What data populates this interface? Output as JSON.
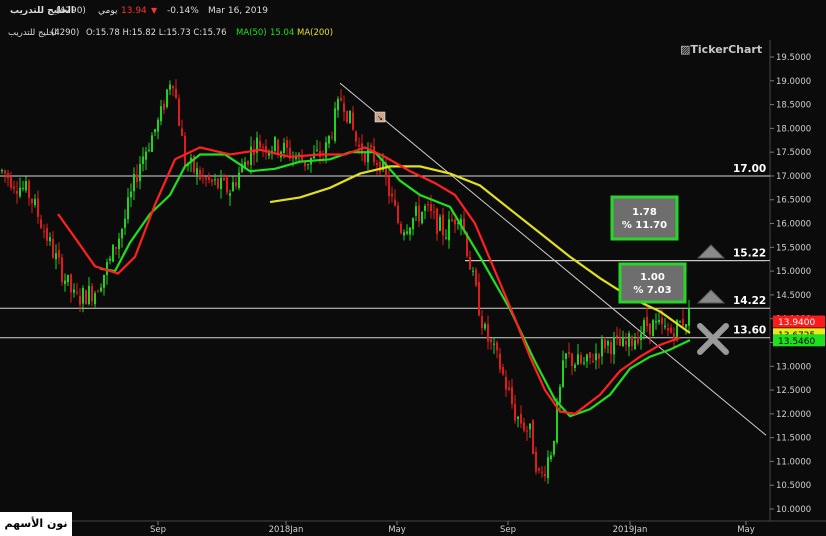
{
  "header": {
    "title": "الخليج للتدريب",
    "code": "(4290)",
    "period": "يومي",
    "price": "13.94",
    "change": "-0.14%",
    "date": "Mar 16, 2019",
    "ohlc_name": "الخليج للتدريب",
    "ohlc_code": "(4290)",
    "ohlc": "O:15.78  H:15.82  L:15.73  C:15.76",
    "ma50_label": "MA(50)",
    "ma50_value": "15.04",
    "ma200_label": "MA(200)"
  },
  "brand": "TickerChart",
  "watermark": "نون الأسهم",
  "colors": {
    "background": "#0b0b0b",
    "up": "#1fd31f",
    "down": "#e01b1b",
    "ma50": "#1fe01f",
    "ma200": "#e0e01f",
    "ma_red": "#ff2020",
    "level_line": "#d8d8d8",
    "box_border": "#2ad52a",
    "box_fill": "#6e6e6e"
  },
  "chart_data": {
    "type": "candlestick",
    "ylim": [
      9.8,
      19.8
    ],
    "y_ticks": [
      "19.5000",
      "19.0000",
      "18.5000",
      "18.0000",
      "17.5000",
      "17.0000",
      "16.5000",
      "16.0000",
      "15.5000",
      "15.0000",
      "14.5000",
      "14.0000",
      "13.5000",
      "13.0000",
      "12.5000",
      "12.0000",
      "11.5000",
      "11.0000",
      "10.5000",
      "10.0000"
    ],
    "x_ticks": [
      "Sep",
      "2018Jan",
      "May",
      "Sep",
      "2019Jan",
      "May"
    ],
    "levels": [
      {
        "value": 17.0,
        "label": "17.00"
      },
      {
        "value": 15.22,
        "label": "15.22"
      },
      {
        "value": 14.22,
        "label": "14.22"
      },
      {
        "value": 13.6,
        "label": "13.60"
      }
    ],
    "price_tags": [
      {
        "value": 13.94,
        "label": "13.9400",
        "color": "#ff1a1a",
        "text": "#ffffff"
      },
      {
        "value": 13.6725,
        "label": "13.6725",
        "color": "#e8e81a",
        "text": "#000000"
      },
      {
        "value": 13.546,
        "label": "13.5460",
        "color": "#1fe01f",
        "text": "#000000"
      }
    ],
    "annotations": [
      {
        "line1": "1.78",
        "line2": "% 11.70"
      },
      {
        "line1": "1.00",
        "line2": "% 7.03"
      }
    ],
    "series": [
      {
        "name": "MA(50)",
        "color": "#1fe01f",
        "points": [
          [
            100,
            15.05
          ],
          [
            115,
            15.0
          ],
          [
            130,
            15.6
          ],
          [
            150,
            16.2
          ],
          [
            170,
            16.6
          ],
          [
            185,
            17.2
          ],
          [
            200,
            17.45
          ],
          [
            225,
            17.45
          ],
          [
            250,
            17.1
          ],
          [
            275,
            17.15
          ],
          [
            300,
            17.3
          ],
          [
            330,
            17.35
          ],
          [
            350,
            17.5
          ],
          [
            375,
            17.5
          ],
          [
            400,
            16.9
          ],
          [
            420,
            16.6
          ],
          [
            450,
            16.35
          ],
          [
            480,
            15.3
          ],
          [
            510,
            14.2
          ],
          [
            535,
            13.1
          ],
          [
            555,
            12.3
          ],
          [
            570,
            11.95
          ],
          [
            590,
            12.1
          ],
          [
            610,
            12.4
          ],
          [
            630,
            12.95
          ],
          [
            650,
            13.2
          ],
          [
            670,
            13.35
          ],
          [
            690,
            13.55
          ]
        ]
      },
      {
        "name": "MA(200)",
        "color": "#e0e01f",
        "points": [
          [
            270,
            16.45
          ],
          [
            300,
            16.55
          ],
          [
            330,
            16.75
          ],
          [
            360,
            17.05
          ],
          [
            390,
            17.2
          ],
          [
            420,
            17.2
          ],
          [
            450,
            17.05
          ],
          [
            480,
            16.8
          ],
          [
            510,
            16.3
          ],
          [
            540,
            15.8
          ],
          [
            570,
            15.3
          ],
          [
            600,
            14.85
          ],
          [
            630,
            14.45
          ],
          [
            660,
            14.15
          ],
          [
            690,
            13.7
          ]
        ]
      },
      {
        "name": "",
        "color": "#ff2020",
        "points": [
          [
            58,
            16.2
          ],
          [
            75,
            15.7
          ],
          [
            95,
            15.1
          ],
          [
            118,
            14.95
          ],
          [
            135,
            15.3
          ],
          [
            155,
            16.4
          ],
          [
            175,
            17.35
          ],
          [
            200,
            17.6
          ],
          [
            230,
            17.45
          ],
          [
            260,
            17.55
          ],
          [
            290,
            17.4
          ],
          [
            320,
            17.45
          ],
          [
            345,
            17.45
          ],
          [
            365,
            17.6
          ],
          [
            385,
            17.4
          ],
          [
            410,
            17.1
          ],
          [
            435,
            16.85
          ],
          [
            455,
            16.6
          ],
          [
            475,
            16.0
          ],
          [
            495,
            15.0
          ],
          [
            515,
            14.0
          ],
          [
            530,
            13.2
          ],
          [
            545,
            12.5
          ],
          [
            560,
            12.05
          ],
          [
            575,
            12.0
          ],
          [
            600,
            12.4
          ],
          [
            620,
            12.9
          ],
          [
            640,
            13.2
          ],
          [
            660,
            13.45
          ],
          [
            680,
            13.6
          ]
        ]
      }
    ],
    "trendlines": [
      {
        "from": [
          340,
          18.95
        ],
        "to": [
          766,
          11.55
        ]
      },
      {
        "from": [
          465,
          15.22
        ],
        "to": [
          766,
          15.22
        ]
      }
    ]
  }
}
